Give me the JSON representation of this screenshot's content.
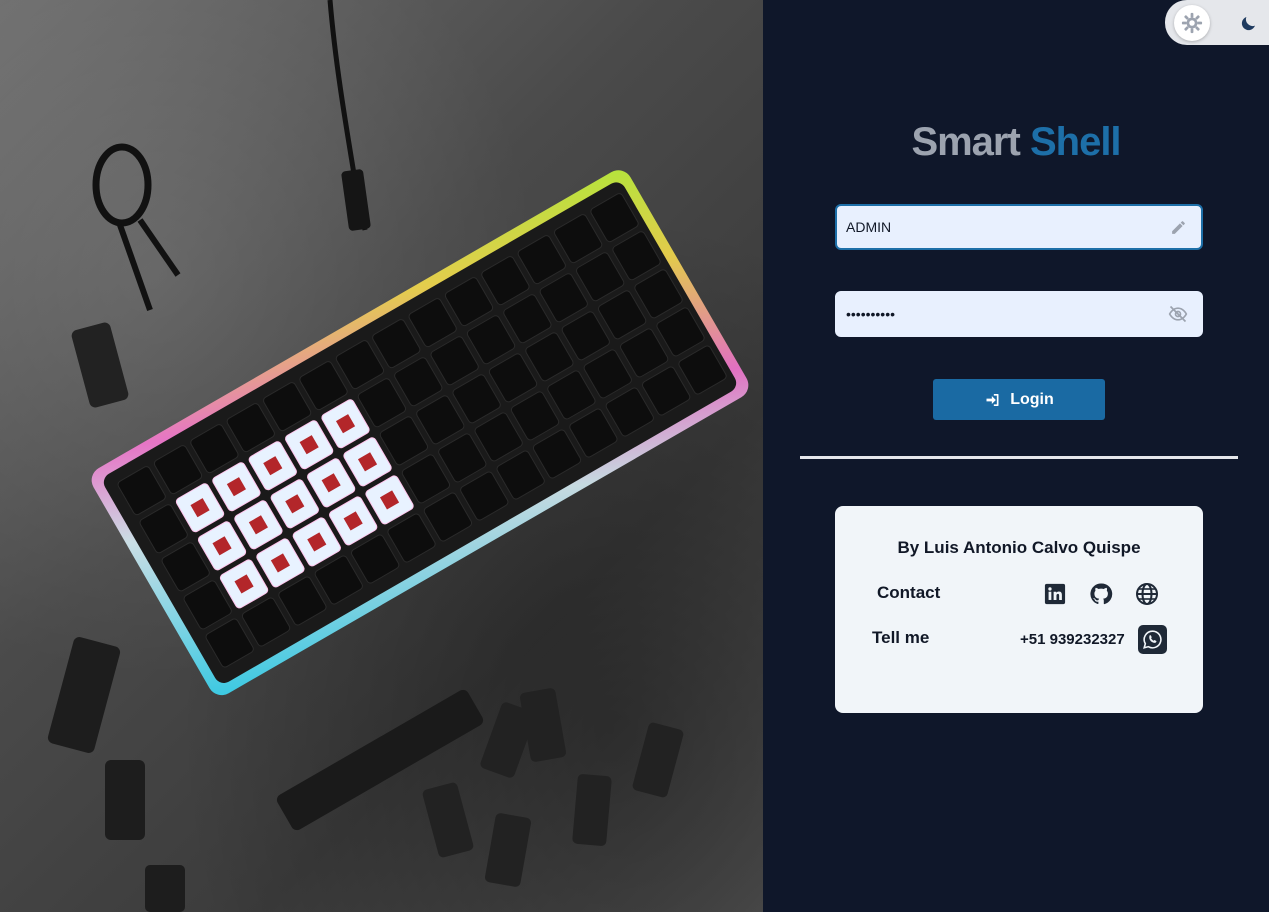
{
  "theme": {
    "light_icon": "sun-gear-icon",
    "dark_icon": "moon-icon"
  },
  "brand": {
    "part1": "Smart",
    "part2": "Shell"
  },
  "login_form": {
    "username_value": "ADMIN",
    "username_icon": "pencil-icon",
    "password_value": "••••••••••",
    "password_icon": "eye-off-icon",
    "login_label": "Login",
    "login_icon": "sign-in-icon"
  },
  "credits": {
    "author": "By Luis Antonio Calvo Quispe",
    "contact_label": "Contact",
    "tell_label": "Tell me",
    "phone": "+51 939232327",
    "social_icons": [
      "linkedin-icon",
      "github-icon",
      "globe-icon"
    ],
    "whatsapp_icon": "whatsapp-icon"
  },
  "colors": {
    "panel_bg": "#0f172a",
    "accent": "#1a6aa3",
    "brand_gray": "#9ca3af",
    "card_bg": "#f1f5f9"
  },
  "hero": {
    "description_icon": "rgb-keyboard-image"
  }
}
